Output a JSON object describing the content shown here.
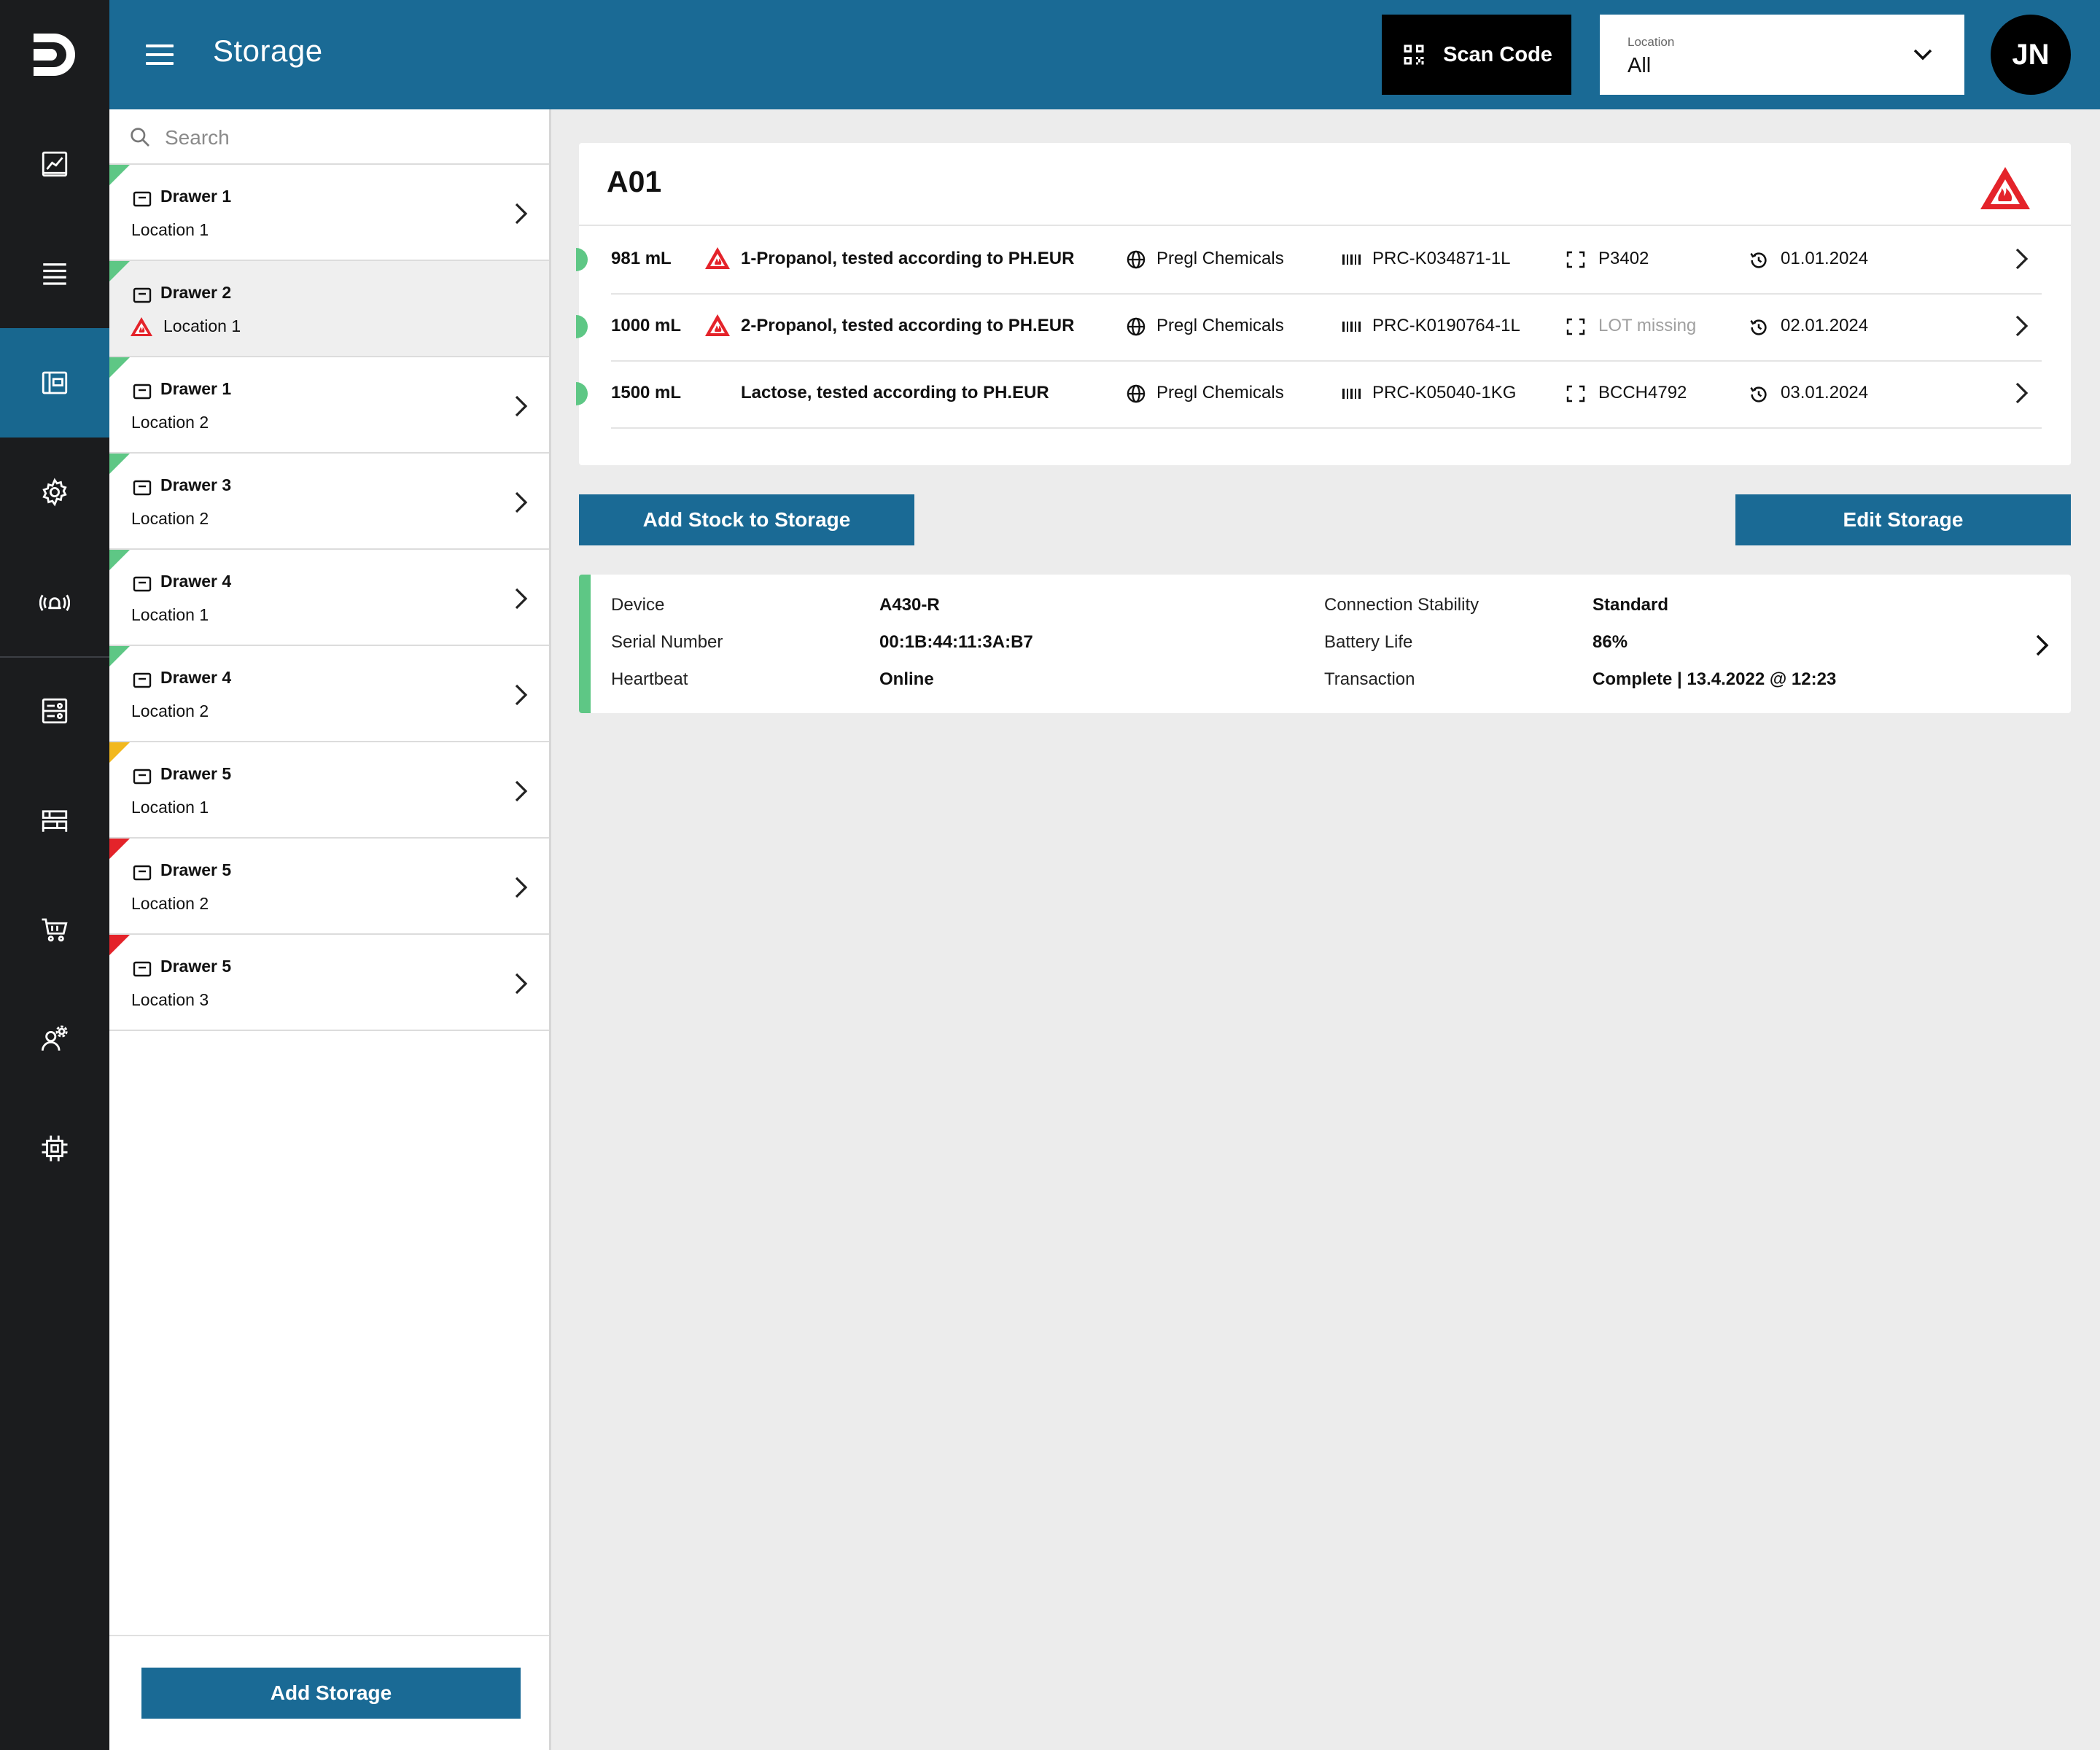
{
  "header": {
    "title": "Storage",
    "scan_label": "Scan Code",
    "location_label": "Location",
    "location_value": "All",
    "avatar_initials": "JN",
    "brand_color": "#1a6a95"
  },
  "rail": {
    "items": [
      {
        "icon": "dashboard-chart-icon"
      },
      {
        "icon": "list-icon"
      },
      {
        "icon": "storage-icon",
        "active": true
      },
      {
        "icon": "settings-gear-icon"
      },
      {
        "icon": "alarm-signal-icon"
      },
      {
        "icon": "inventory-form-icon"
      },
      {
        "icon": "shelves-icon"
      },
      {
        "icon": "cart-icon"
      },
      {
        "icon": "user-settings-icon"
      },
      {
        "icon": "chip-icon"
      }
    ]
  },
  "search": {
    "placeholder": "Search"
  },
  "list": {
    "items": [
      {
        "name": "Drawer 1",
        "location": "Location 1",
        "status": "green"
      },
      {
        "name": "Drawer 2",
        "location": "Location 1",
        "status": "green",
        "hazard": true,
        "selected": true
      },
      {
        "name": "Drawer 1",
        "location": "Location 2",
        "status": "green"
      },
      {
        "name": "Drawer 3",
        "location": "Location 2",
        "status": "green"
      },
      {
        "name": "Drawer 4",
        "location": "Location 1",
        "status": "green"
      },
      {
        "name": "Drawer 4",
        "location": "Location 2",
        "status": "green"
      },
      {
        "name": "Drawer 5",
        "location": "Location 1",
        "status": "yellow"
      },
      {
        "name": "Drawer 5",
        "location": "Location 2",
        "status": "red"
      },
      {
        "name": "Drawer 5",
        "location": "Location 3",
        "status": "red"
      }
    ],
    "add_button": "Add Storage"
  },
  "storage": {
    "title": "A01",
    "rows": [
      {
        "qty": "981 mL",
        "hazard": true,
        "name": "1-Propanol, tested according to PH.EUR",
        "supplier": "Pregl Chemicals",
        "sku": "PRC-K034871-1L",
        "lot": "P3402",
        "date": "01.01.2024"
      },
      {
        "qty": "1000 mL",
        "hazard": true,
        "name": "2-Propanol, tested according to PH.EUR",
        "supplier": "Pregl Chemicals",
        "sku": "PRC-K0190764-1L",
        "lot": "LOT missing",
        "lot_missing": true,
        "date": "02.01.2024"
      },
      {
        "qty": "1500 mL",
        "hazard": false,
        "name": "Lactose, tested according to PH.EUR",
        "supplier": "Pregl Chemicals",
        "sku": "PRC-K05040-1KG",
        "lot": "BCCH4792",
        "date": "03.01.2024"
      }
    ]
  },
  "actions": {
    "add_stock": "Add Stock to Storage",
    "edit_storage": "Edit Storage"
  },
  "device": {
    "labels": {
      "device": "Device",
      "serial": "Serial Number",
      "heartbeat": "Heartbeat",
      "stability": "Connection Stability",
      "battery": "Battery Life",
      "transaction": "Transaction"
    },
    "values": {
      "device": "A430-R",
      "serial": "00:1B:44:11:3A:B7",
      "heartbeat": "Online",
      "stability": "Standard",
      "battery": "86%",
      "transaction": "Complete | 13.4.2022 @ 12:23"
    }
  },
  "colors": {
    "status_green": "#5ec785",
    "status_yellow": "#f2b81e",
    "status_red": "#e4232a",
    "hazard_red": "#e4232a"
  }
}
